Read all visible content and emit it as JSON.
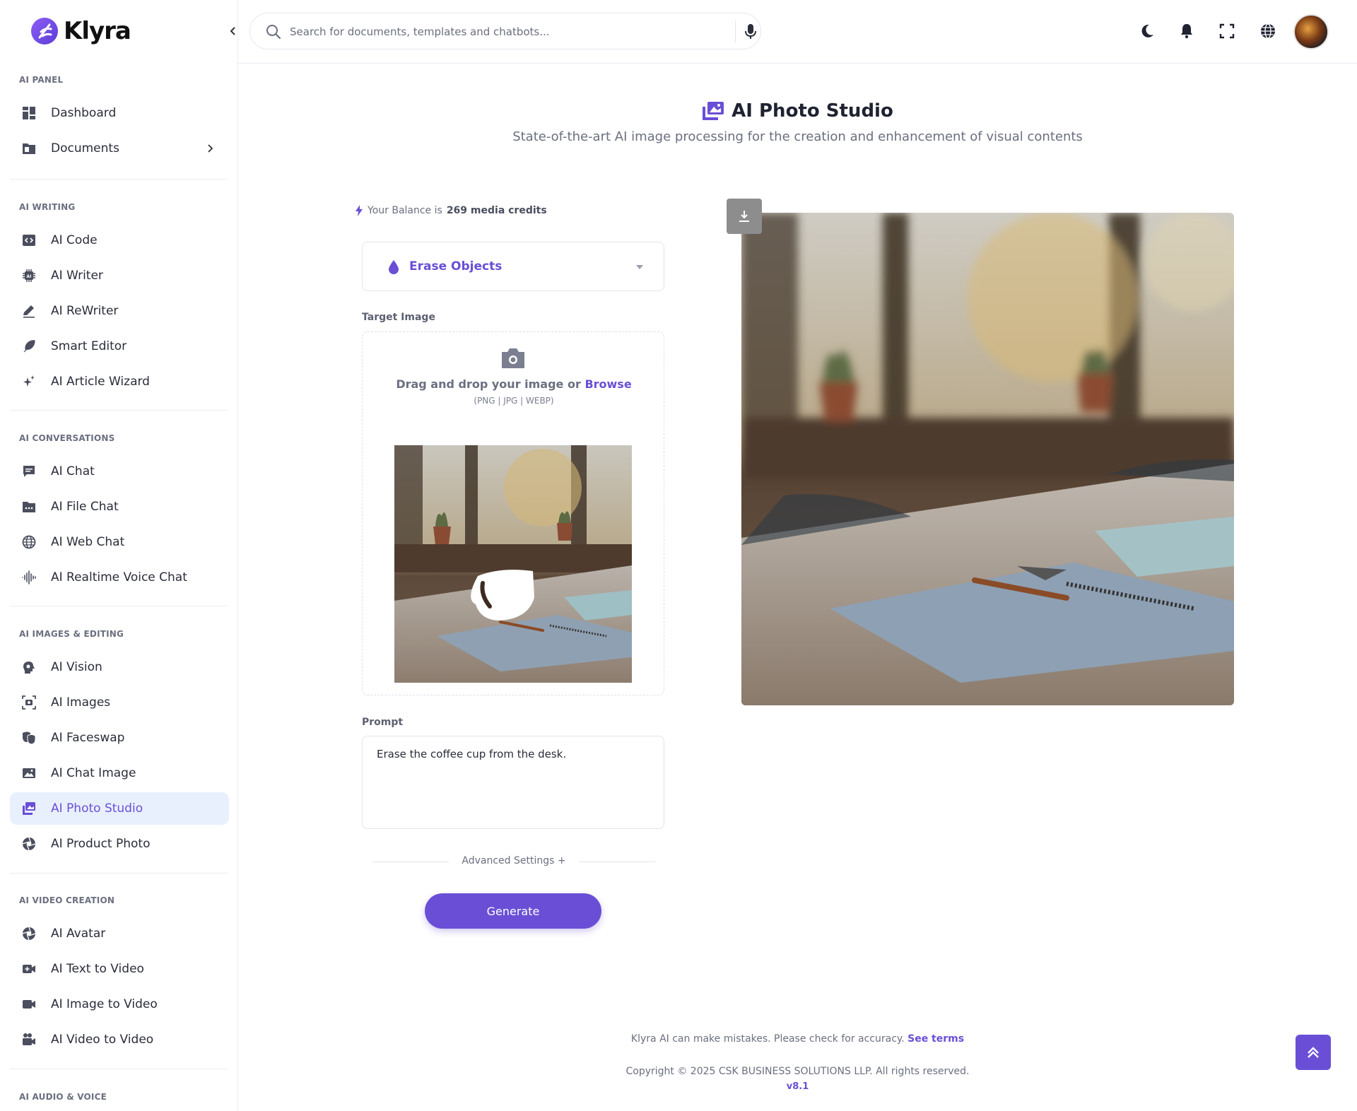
{
  "app": {
    "name": "Klyra"
  },
  "search": {
    "placeholder": "Search for documents, templates and chatbots..."
  },
  "sidebar": {
    "sections": {
      "ai_panel": "AI PANEL",
      "ai_writing": "AI WRITING",
      "ai_conversations": "AI CONVERSATIONS",
      "ai_images": "AI IMAGES & EDITING",
      "ai_video": "AI VIDEO CREATION",
      "ai_audio": "AI AUDIO & VOICE"
    },
    "items": {
      "dashboard": "Dashboard",
      "documents": "Documents",
      "ai_code": "AI Code",
      "ai_writer": "AI Writer",
      "ai_rewriter": "AI ReWriter",
      "smart_editor": "Smart Editor",
      "ai_article_wizard": "AI Article Wizard",
      "ai_chat": "AI Chat",
      "ai_file_chat": "AI File Chat",
      "ai_web_chat": "AI Web Chat",
      "ai_realtime_voice_chat": "AI Realtime Voice Chat",
      "ai_vision": "AI Vision",
      "ai_images": "AI Images",
      "ai_faceswap": "AI Faceswap",
      "ai_chat_image": "AI Chat Image",
      "ai_photo_studio": "AI Photo Studio",
      "ai_product_photo": "AI Product Photo",
      "ai_avatar": "AI Avatar",
      "ai_text_to_video": "AI Text to Video",
      "ai_image_to_video": "AI Image to Video",
      "ai_video_to_video": "AI Video to Video"
    },
    "active_item": "AI Photo Studio"
  },
  "page": {
    "title": "AI Photo Studio",
    "subtitle": "State-of-the-art AI image processing for the creation and enhancement of visual contents"
  },
  "balance": {
    "prefix": "Your Balance is",
    "amount": "269 media credits"
  },
  "tool_select": {
    "value": "Erase Objects"
  },
  "upload": {
    "label": "Target Image",
    "drag_text": "Drag and drop your image or",
    "browse": "Browse",
    "formats": "(PNG | JPG | WEBP)"
  },
  "prompt": {
    "label": "Prompt",
    "value": "Erase the coffee cup from the desk."
  },
  "advanced_settings": "Advanced Settings +",
  "generate_label": "Generate",
  "footer": {
    "disclaimer": "Klyra AI can make mistakes. Please check for accuracy.",
    "terms": "See terms",
    "copyright": "Copyright © 2025 CSK BUSINESS SOLUTIONS LLP. All rights reserved.",
    "version": "v8.1"
  },
  "colors": {
    "accent": "#6a4fd6",
    "active_bg": "#e8f0fd",
    "text": "#1f2230",
    "muted": "#6b6f80"
  },
  "icons": {
    "top": [
      "moon-icon",
      "bell-icon",
      "fullscreen-icon",
      "globe-icon"
    ],
    "scroll_top": "double-chevron-up-icon",
    "download": "download-icon"
  }
}
